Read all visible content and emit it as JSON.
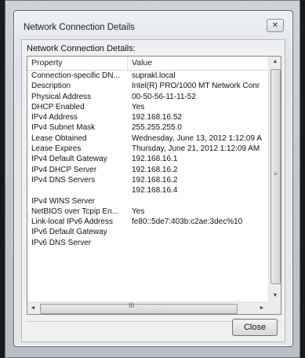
{
  "window": {
    "title": "Network Connection Details",
    "close_glyph": "✕"
  },
  "section_label": "Network Connection Details:",
  "columns": {
    "property": "Property",
    "value": "Value"
  },
  "rows": [
    {
      "property": "Connection-specific DN...",
      "value": "suprakl.local"
    },
    {
      "property": "Description",
      "value": "Intel(R) PRO/1000 MT Network Conr"
    },
    {
      "property": "Physical Address",
      "value": "00-50-56-11-11-52"
    },
    {
      "property": "DHCP Enabled",
      "value": "Yes"
    },
    {
      "property": "IPv4 Address",
      "value": "192.168.16.52"
    },
    {
      "property": "IPv4 Subnet Mask",
      "value": "255.255.255.0"
    },
    {
      "property": "Lease Obtained",
      "value": "Wednesday, June 13, 2012 1:12:09 A"
    },
    {
      "property": "Lease Expires",
      "value": "Thursday, June 21, 2012 1:12:09 AM"
    },
    {
      "property": "IPv4 Default Gateway",
      "value": "192.168.16.1"
    },
    {
      "property": "IPv4 DHCP Server",
      "value": "192.168.16.2"
    },
    {
      "property": "IPv4 DNS Servers",
      "value": "192.168.16.2"
    },
    {
      "property": "",
      "value": "192.168.16.4"
    },
    {
      "property": "IPv4 WINS Server",
      "value": ""
    },
    {
      "property": "NetBIOS over Tcpip En...",
      "value": "Yes"
    },
    {
      "property": "Link-local IPv6 Address",
      "value": "fe80::5de7:403b:c2ae:3dec%10"
    },
    {
      "property": "IPv6 Default Gateway",
      "value": ""
    },
    {
      "property": "IPv6 DNS Server",
      "value": ""
    }
  ],
  "scroll": {
    "up": "▲",
    "down": "▼",
    "left": "◄",
    "right": "►",
    "hgrip": "III",
    "vgrip": "≡"
  },
  "buttons": {
    "close": "Close"
  }
}
